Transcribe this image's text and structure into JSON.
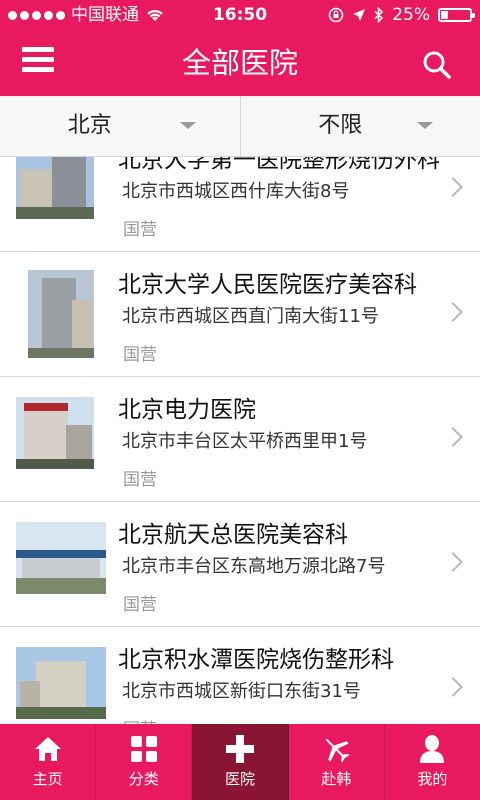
{
  "status_bar": {
    "carrier": "中国联通",
    "time": "16:50",
    "battery": "25%",
    "battery_level": 0.25
  },
  "header": {
    "title": "全部医院",
    "menu_icon": "menu-icon",
    "search_icon": "search-icon"
  },
  "filters": [
    {
      "label": "北京"
    },
    {
      "label": "不限"
    }
  ],
  "hospitals": [
    {
      "name": "北京大学第一医院整形烧伤外科",
      "address": "北京市西城区西什库大街8号",
      "type": "国营"
    },
    {
      "name": "北京大学人民医院医疗美容科",
      "address": "北京市西城区西直门南大街11号",
      "type": "国营"
    },
    {
      "name": "北京电力医院",
      "address": "北京市丰台区太平桥西里甲1号",
      "type": "国营"
    },
    {
      "name": "北京航天总医院美容科",
      "address": "北京市丰台区东高地万源北路7号",
      "type": "国营"
    },
    {
      "name": "北京积水潭医院烧伤整形科",
      "address": "北京市西城区新街口东街31号",
      "type": "国营"
    }
  ],
  "tabs": [
    {
      "label": "主页",
      "icon": "home-icon"
    },
    {
      "label": "分类",
      "icon": "grid-icon"
    },
    {
      "label": "医院",
      "icon": "plus-icon",
      "active": true
    },
    {
      "label": "赴韩",
      "icon": "airplane-icon"
    },
    {
      "label": "我的",
      "icon": "user-icon"
    }
  ],
  "colors": {
    "brand": "#e8195f",
    "active_tab": "#8a1532"
  }
}
